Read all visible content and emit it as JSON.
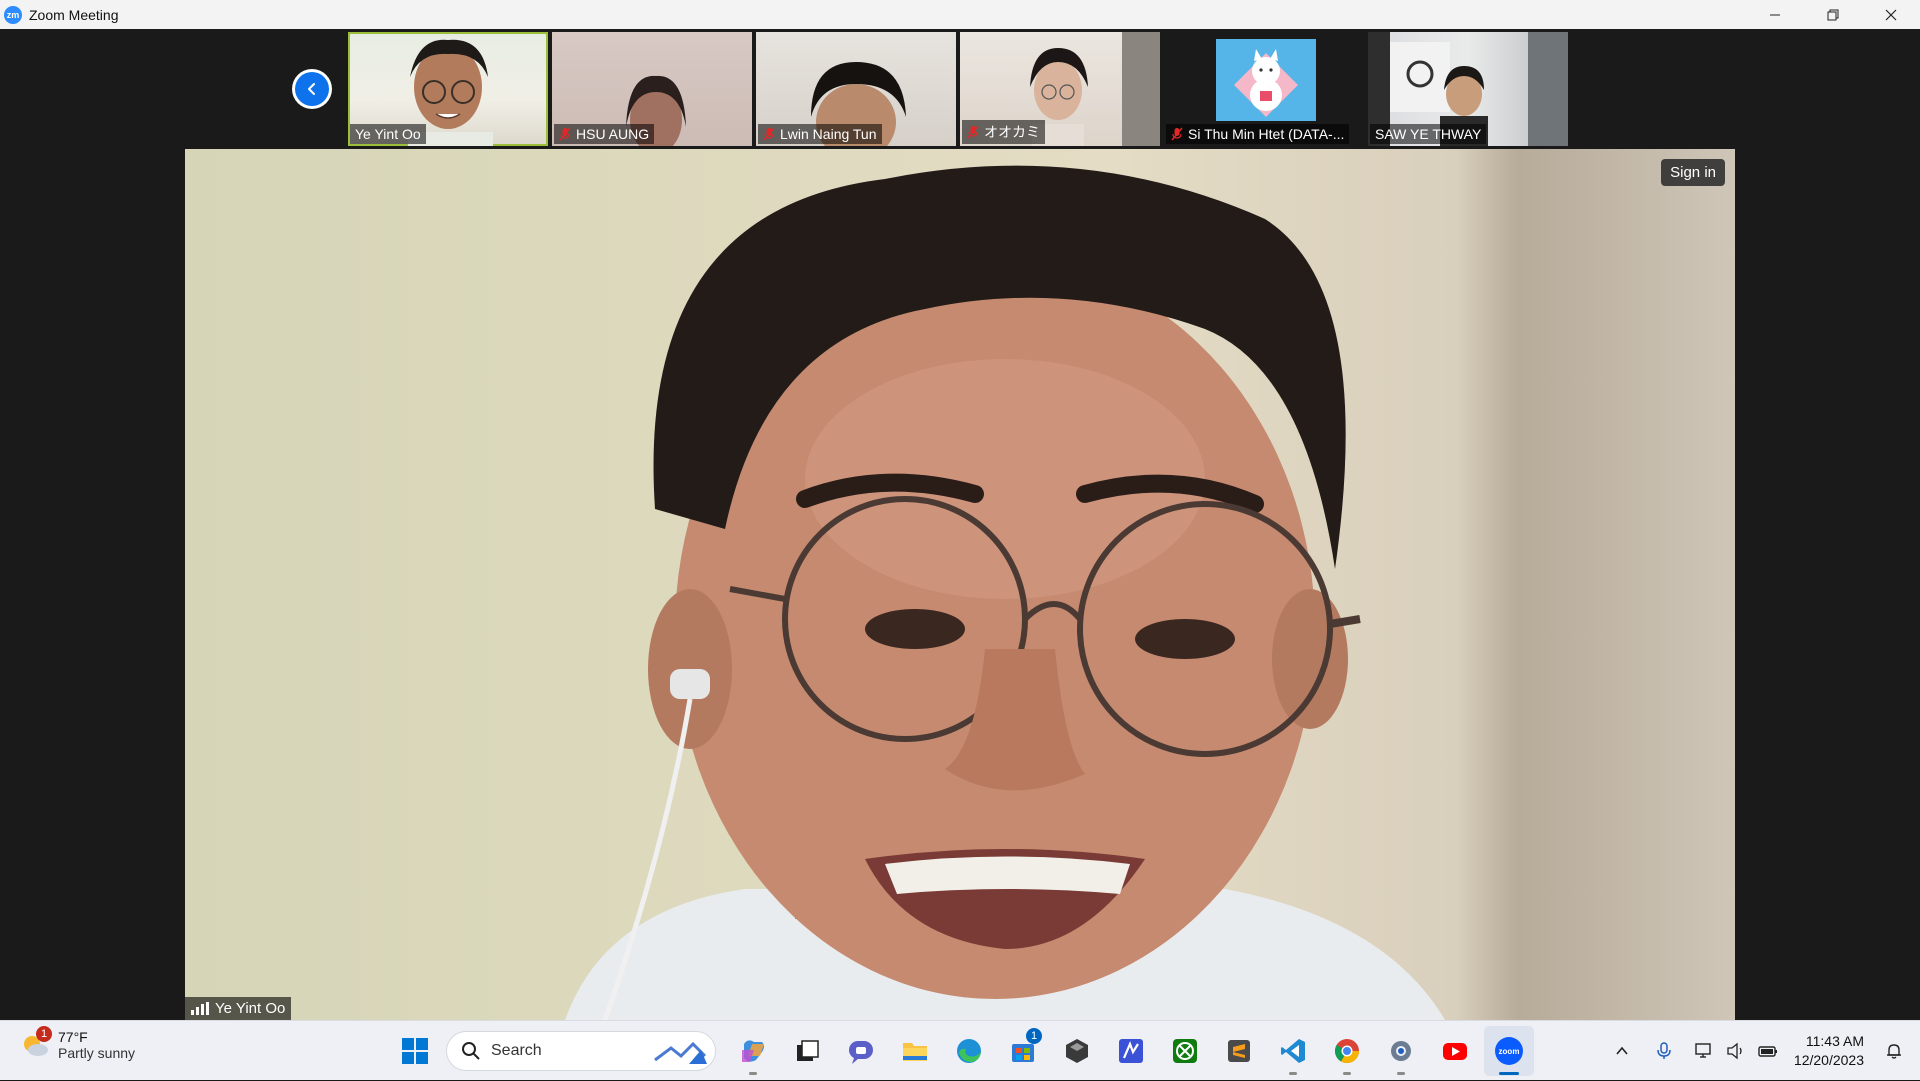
{
  "window": {
    "app_icon_text": "zm",
    "title": "Zoom Meeting"
  },
  "gallery": {
    "thumbnails": [
      {
        "name": "Ye Yint Oo",
        "muted": false,
        "active": true
      },
      {
        "name": "HSU AUNG",
        "muted": true,
        "active": false
      },
      {
        "name": "Lwin Naing Tun",
        "muted": true,
        "active": false
      },
      {
        "name": "オオカミ",
        "muted": true,
        "active": false
      },
      {
        "name": "Si Thu Min Htet (DATA-...",
        "muted": true,
        "active": false
      },
      {
        "name": "SAW YE THWAY",
        "muted": false,
        "active": false
      }
    ]
  },
  "main_video": {
    "speaker_name": "Ye Yint Oo",
    "sign_in_label": "Sign in"
  },
  "taskbar": {
    "weather": {
      "badge": "1",
      "temperature": "77°F",
      "condition": "Partly sunny"
    },
    "search_label": "Search",
    "store_badge": "1",
    "zoom_label": "zoom",
    "clock": {
      "time": "11:43 AM",
      "date": "12/20/2023"
    }
  },
  "colors": {
    "zoom_blue": "#0e72ed",
    "active_speaker_border": "#9bbf3a",
    "muted_red": "#e02828",
    "taskbar_bg": "#eef0f5"
  }
}
